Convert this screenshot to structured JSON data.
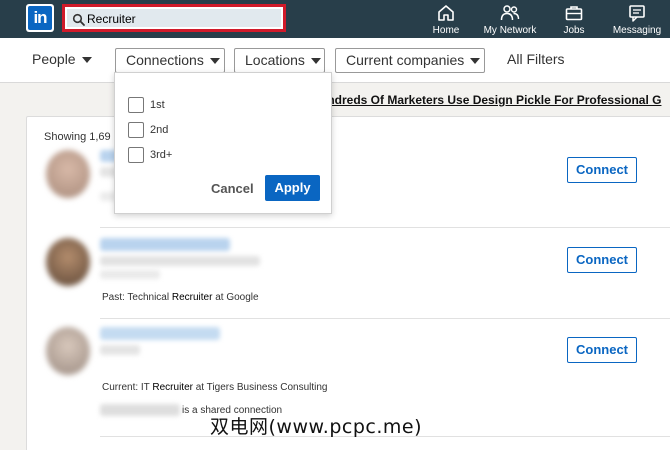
{
  "header": {
    "logo_text": "in",
    "search": {
      "value": "Recruiter",
      "icon": "search-icon"
    },
    "nav": [
      {
        "label": "Home",
        "icon": "home-icon"
      },
      {
        "label": "My Network",
        "icon": "people-icon"
      },
      {
        "label": "Jobs",
        "icon": "briefcase-icon"
      },
      {
        "label": "Messaging",
        "icon": "chat-icon"
      }
    ]
  },
  "filters": {
    "people": "People",
    "connections": "Connections",
    "locations": "Locations",
    "current_companies": "Current companies",
    "all_filters": "All Filters"
  },
  "ad_text": "undreds Of Marketers Use Design Pickle For Professional G",
  "dropdown": {
    "options": [
      "1st",
      "2nd",
      "3rd+"
    ],
    "cancel": "Cancel",
    "apply": "Apply"
  },
  "results": {
    "showing": "Showing 1,69",
    "connect_label": "Connect",
    "items": [
      {
        "prefix": "",
        "keyword": "",
        "suffix": "",
        "shared": ""
      },
      {
        "prefix": "Past: Technical ",
        "keyword": "Recruiter",
        "suffix": " at Google",
        "shared": ""
      },
      {
        "prefix": "Current: IT ",
        "keyword": "Recruiter",
        "suffix": " at Tigers Business Consulting",
        "shared": "is a shared connection"
      }
    ]
  },
  "watermark": "双电网(www.pcpc.me)",
  "colors": {
    "header_bg": "#283e4a",
    "accent": "#0a66c2",
    "search_highlight": "#d11a2a"
  }
}
